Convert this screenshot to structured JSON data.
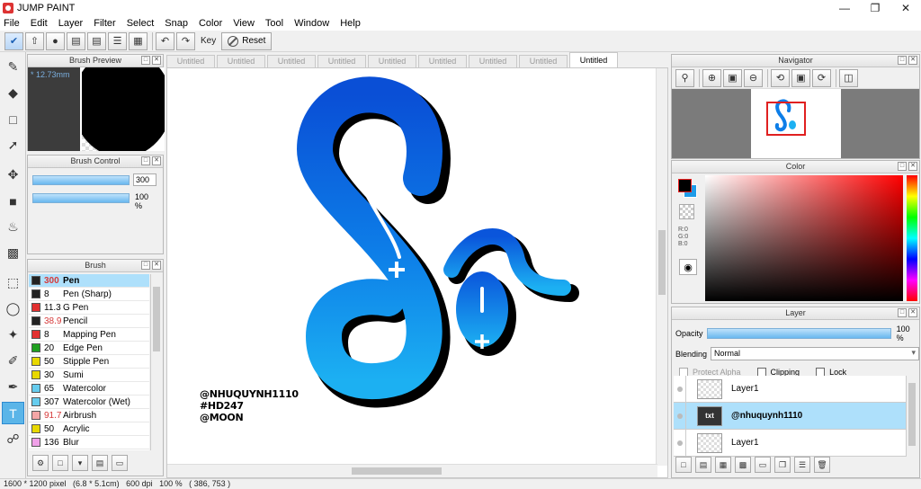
{
  "window": {
    "title": "JUMP PAINT"
  },
  "menu": [
    "File",
    "Edit",
    "Layer",
    "Filter",
    "Select",
    "Snap",
    "Color",
    "View",
    "Tool",
    "Window",
    "Help"
  ],
  "toolbar": {
    "key_label": "Key",
    "reset_label": "Reset"
  },
  "panels": {
    "brush_preview": {
      "title": "Brush Preview",
      "size_label": "* 12.73mm"
    },
    "brush_control": {
      "title": "Brush Control",
      "size_value": "300",
      "opacity_value": "100 %"
    },
    "brush": {
      "title": "Brush"
    },
    "navigator": {
      "title": "Navigator"
    },
    "color": {
      "title": "Color",
      "r": "R:0",
      "g": "G:0",
      "b": "B:0"
    },
    "layer": {
      "title": "Layer",
      "opacity_label": "Opacity",
      "opacity_value": "100 %",
      "blending_label": "Blending",
      "blending_value": "Normal",
      "protect_alpha": "Protect Alpha",
      "clipping": "Clipping",
      "lock": "Lock"
    }
  },
  "brushes": [
    {
      "size": "300",
      "name": "Pen",
      "color": "#222222",
      "red": true,
      "selected": true
    },
    {
      "size": "8",
      "name": "Pen (Sharp)",
      "color": "#222222",
      "red": false,
      "selected": false
    },
    {
      "size": "11.3",
      "name": "G Pen",
      "color": "#e23030",
      "red": false,
      "selected": false
    },
    {
      "size": "38.9",
      "name": "Pencil",
      "color": "#222222",
      "red": true,
      "selected": false
    },
    {
      "size": "8",
      "name": "Mapping Pen",
      "color": "#e23030",
      "red": false,
      "selected": false
    },
    {
      "size": "20",
      "name": "Edge Pen",
      "color": "#20a020",
      "red": false,
      "selected": false
    },
    {
      "size": "50",
      "name": "Stipple Pen",
      "color": "#e8d800",
      "red": false,
      "selected": false
    },
    {
      "size": "30",
      "name": "Sumi",
      "color": "#e8d800",
      "red": false,
      "selected": false
    },
    {
      "size": "65",
      "name": "Watercolor",
      "color": "#66ccee",
      "red": false,
      "selected": false
    },
    {
      "size": "307",
      "name": "Watercolor (Wet)",
      "color": "#66ccee",
      "red": false,
      "selected": false
    },
    {
      "size": "91.7",
      "name": "Airbrush",
      "color": "#f4a6a6",
      "red": true,
      "selected": false
    },
    {
      "size": "50",
      "name": "Acrylic",
      "color": "#e8d800",
      "red": false,
      "selected": false
    },
    {
      "size": "136",
      "name": "Blur",
      "color": "#f0a0e8",
      "red": false,
      "selected": false
    }
  ],
  "doc_tabs": [
    "Untitled",
    "Untitled",
    "Untitled",
    "Untitled",
    "Untitled",
    "Untitled",
    "Untitled",
    "Untitled",
    "Untitled"
  ],
  "active_tab_index": 8,
  "canvas": {
    "signature": [
      "@NHUQUYNH1110",
      "#HD247",
      "@MOON"
    ]
  },
  "layers": [
    {
      "name": "Layer1",
      "selected": false,
      "thumb": ""
    },
    {
      "name": "@nhuquynh1110",
      "selected": true,
      "thumb": "txt"
    },
    {
      "name": "Layer1",
      "selected": false,
      "thumb": ""
    }
  ],
  "status": {
    "text": "1600 * 1200 pixel   (6.8 * 5.1cm)   600 dpi   100 %   ( 386, 753 )"
  },
  "colors": {
    "accent": "#5bb5e8",
    "selection": "#aee0fb",
    "art_dark": "#0a4fd6",
    "art_light": "#1cb0f2"
  }
}
